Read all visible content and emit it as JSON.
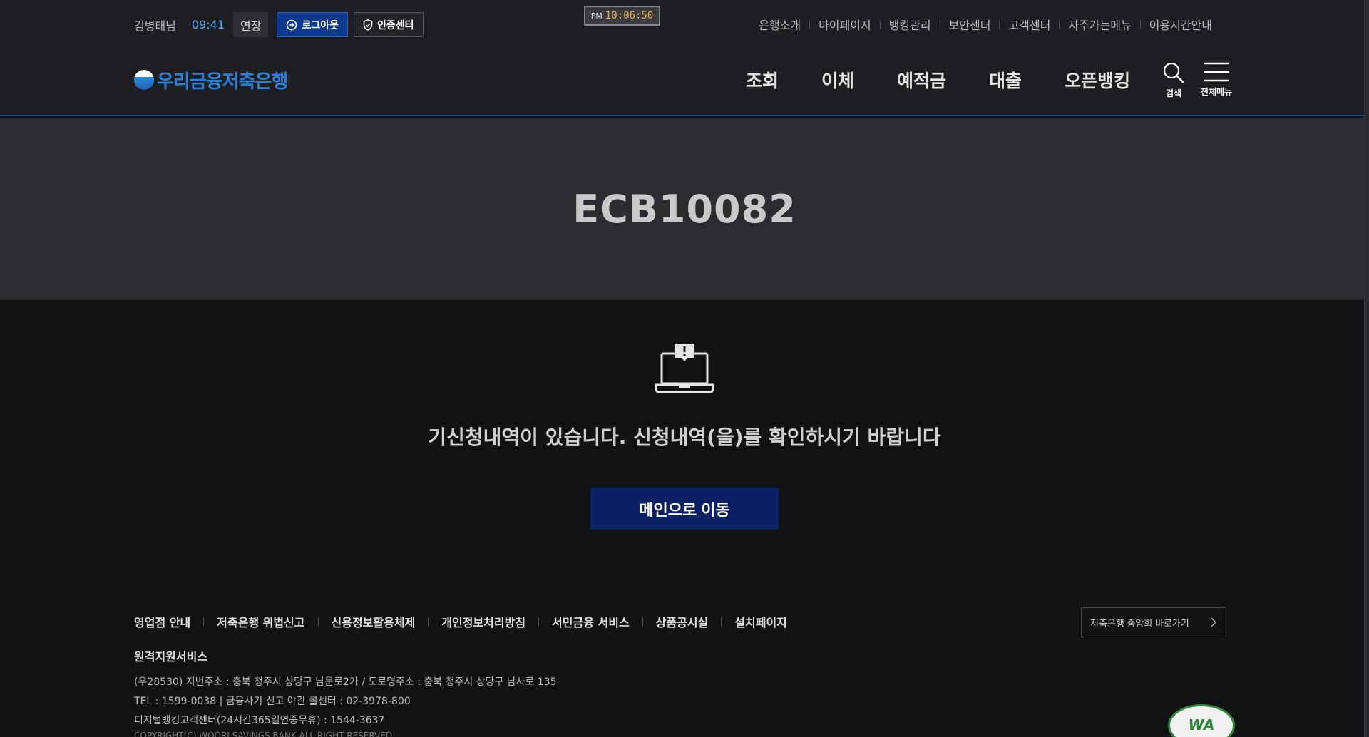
{
  "header": {
    "user_name": "김병태님",
    "session_time": "09:41",
    "extend_label": "연장",
    "logout_label": "로그아웃",
    "cert_center_label": "인증센터",
    "clock": {
      "ampm": "PM",
      "time": "10:06:50"
    },
    "util_links": [
      "은행소개",
      "마이페이지",
      "뱅킹관리",
      "보안센터",
      "고객센터",
      "자주가는메뉴",
      "이용시간안내"
    ],
    "logo_text": "우리금융저축은행",
    "gnb": [
      "조회",
      "이체",
      "예적금",
      "대출",
      "오픈뱅킹"
    ],
    "search_label": "검색",
    "menu_label": "전체메뉴"
  },
  "content": {
    "error_code": "ECB10082",
    "message": "기신청내역이 있습니다. 신청내역(을)를 확인하시기 바랍니다",
    "main_button_label": "메인으로 이동"
  },
  "footer": {
    "links": [
      "영업점 안내",
      "저축은행 위법신고",
      "신용정보활용체제",
      "개인정보처리방침",
      "서민금융 서비스",
      "상품공시실",
      "설치페이지",
      "원격지원서비스"
    ],
    "federation_button_label": "저축은행 중앙회 바로가기",
    "address_lines": [
      "(우28530) 지번주소 : 충북 청주시 상당구 남문로2가 / 도로명주소 : 충북 청주시 상당구 남사로 135",
      "TEL : 1599-0038 | 금융사기 신고 야간 콜센터 : 02-3978-800",
      "디지털뱅킹고객센터(24시간365일연중무휴) : 1544-3637"
    ],
    "copyright": "COPYRIGHT(C) WOORI SAVINGS BANK ALL RIGHT RESERVED",
    "wa_mark_text": "WA"
  },
  "colors": {
    "brand_blue": "#2a7fd4",
    "logout_bg": "#0d3a8f",
    "main_button_bg": "#0c2163",
    "session_time": "#4ea5ff",
    "clock_digits": "#e8b24a"
  },
  "icons": [
    "login-arrow-icon",
    "shield-check-icon",
    "search-icon",
    "hamburger-menu-icon",
    "laptop-alert-icon",
    "chevron-right-icon",
    "wa-certification-icon"
  ]
}
